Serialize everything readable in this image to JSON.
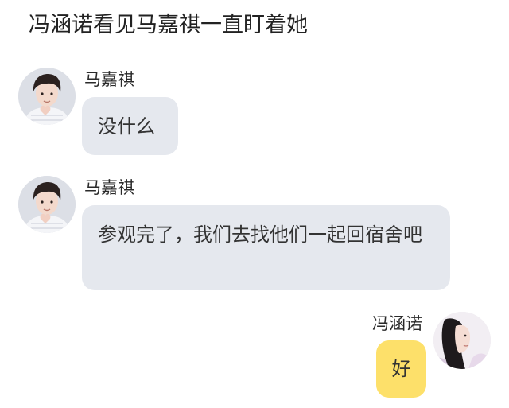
{
  "narration": "冯涵诺看见马嘉祺一直盯着她",
  "messages": [
    {
      "sender": "马嘉祺",
      "text": "没什么",
      "side": "left"
    },
    {
      "sender": "马嘉祺",
      "text": "参观完了，我们去找他们一起回宿舍吧",
      "side": "left"
    },
    {
      "sender": "冯涵诺",
      "text": "好",
      "side": "right"
    }
  ],
  "colors": {
    "left_bubble": "#e5e8ee",
    "right_bubble": "#fde06a",
    "background": "#ffffff"
  },
  "icons": {
    "avatar_left": "boy-avatar-icon",
    "avatar_right": "girl-avatar-icon"
  }
}
